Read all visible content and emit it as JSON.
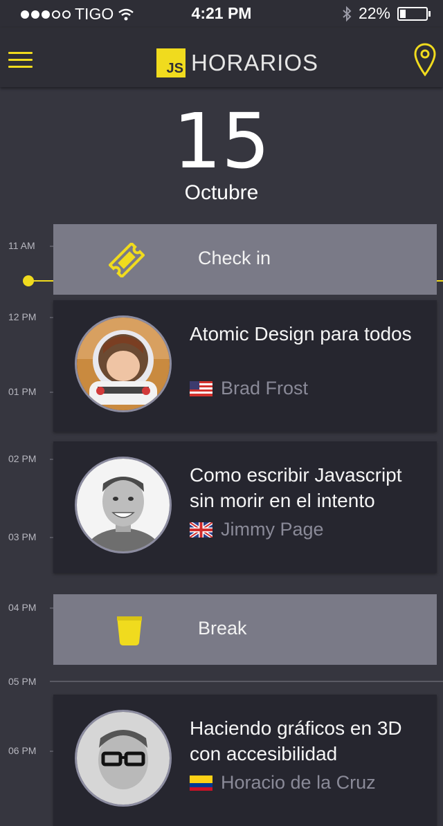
{
  "status_bar": {
    "carrier": "TIGO",
    "time": "4:21 PM",
    "battery": "22%"
  },
  "header": {
    "logo_text": "JS",
    "title": "HORARIOS"
  },
  "date": {
    "day": "15",
    "month": "Octubre"
  },
  "time_labels": [
    "11 AM",
    "12 PM",
    "01 PM",
    "02 PM",
    "03 PM",
    "04 PM",
    "05 PM",
    "06 PM"
  ],
  "checkin": {
    "label": "Check in",
    "icon": "ticket-icon"
  },
  "break": {
    "label": "Break",
    "icon": "cup-icon"
  },
  "talks": [
    {
      "title": "Atomic Design para todos",
      "speaker": "Brad Frost",
      "flag": "us-flag-icon"
    },
    {
      "title": "Como escribir Javascript sin morir en el intento",
      "speaker": "Jimmy Page",
      "flag": "uk-flag-icon"
    },
    {
      "title": "Haciendo gráficos en 3D con accesibilidad",
      "speaker": "Horacio de la Cruz",
      "flag": "colombia-flag-icon"
    }
  ],
  "colors": {
    "accent": "#f0db1e",
    "background": "#36363f",
    "card": "#26262f",
    "event_card": "#7a7a87"
  }
}
